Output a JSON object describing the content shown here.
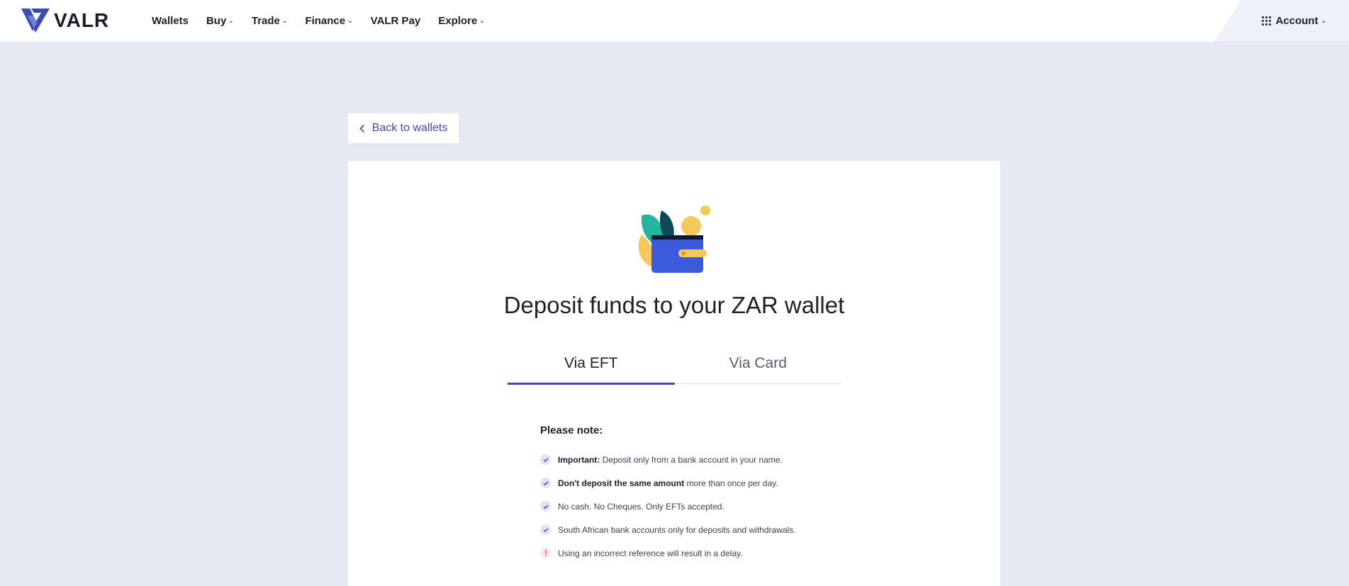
{
  "brand": {
    "name": "VALR",
    "accent": "#3a4bb5",
    "background": "#e6e9f4"
  },
  "nav": {
    "items": [
      {
        "label": "Wallets",
        "dropdown": false
      },
      {
        "label": "Buy",
        "dropdown": true
      },
      {
        "label": "Trade",
        "dropdown": true
      },
      {
        "label": "Finance",
        "dropdown": true
      },
      {
        "label": "VALR Pay",
        "dropdown": false
      },
      {
        "label": "Explore",
        "dropdown": true
      }
    ],
    "account_label": "Account"
  },
  "back_button": {
    "label": "Back to wallets",
    "icon": "chevron-left-icon"
  },
  "card": {
    "illustration": "wallet-with-leaves-and-coins",
    "title": "Deposit funds to your ZAR wallet",
    "tabs": [
      {
        "label": "Via EFT",
        "active": true
      },
      {
        "label": "Via Card",
        "active": false
      }
    ],
    "notes_title": "Please note:",
    "notes": [
      {
        "type": "check",
        "bold": "Important:",
        "text": " Deposit only from a bank account in your name."
      },
      {
        "type": "check",
        "bold": "Don't deposit the same amount",
        "text": " more than once per day."
      },
      {
        "type": "check",
        "bold": "",
        "text": "No cash. No Cheques. Only EFTs accepted."
      },
      {
        "type": "check",
        "bold": "",
        "text": "South African bank accounts only for deposits and withdrawals."
      },
      {
        "type": "warning",
        "bold": "",
        "text": "Using an incorrect reference will result in a delay."
      }
    ]
  }
}
